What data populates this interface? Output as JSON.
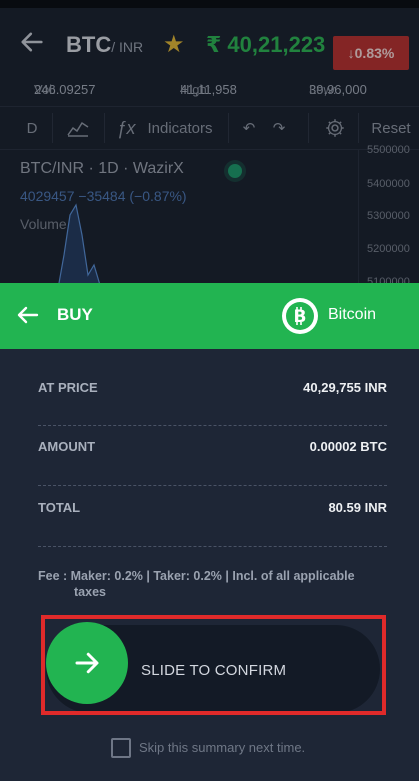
{
  "background": {
    "pair": "BTC",
    "quote": "/ INR",
    "price": "₹ 40,21,223",
    "change": "↓0.83%",
    "stats": {
      "vol_label": "Vol:",
      "vol": "246.09257",
      "high_label": "High:",
      "high": "41,11,958",
      "low_label": "Low:",
      "low": "39,96,000"
    },
    "toolbar": {
      "interval": "D",
      "indicators": "Indicators",
      "reset": "Reset"
    },
    "chart": {
      "title": "BTC/INR · 1D · WazirX",
      "ohlc": "4029457  −35484 (−0.87%)",
      "volume_label": "Volume",
      "y_ticks": [
        "5500000",
        "5400000",
        "5300000",
        "5200000",
        "5100000"
      ]
    }
  },
  "sheet": {
    "title": "BUY",
    "coin": "Bitcoin",
    "rows": [
      {
        "label": "AT PRICE",
        "value": "40,29,755 INR"
      },
      {
        "label": "AMOUNT",
        "value": "0.00002 BTC"
      },
      {
        "label": "TOTAL",
        "value": "80.59 INR"
      }
    ],
    "fee_line1": "Fee :  Maker: 0.2% | Taker: 0.2% | Incl. of all applicable",
    "fee_line2": "taxes",
    "slide_label": "SLIDE TO CONFIRM",
    "skip_label": "Skip this summary next time."
  },
  "colors": {
    "accent_green": "#22b451",
    "price_green": "#2fb457",
    "down_red": "#b83434",
    "highlight_red": "#e02a2a",
    "background": "#1e2636"
  }
}
